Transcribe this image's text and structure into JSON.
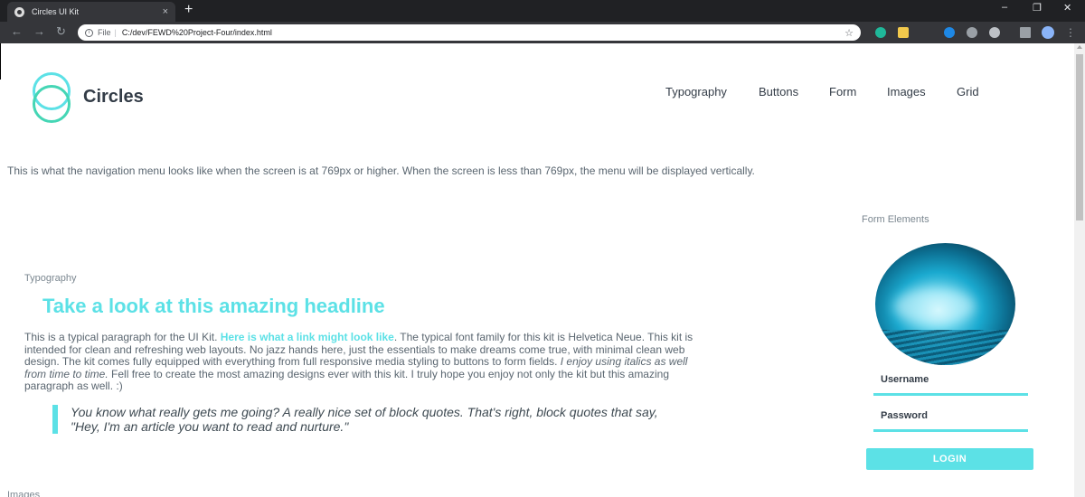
{
  "browser": {
    "tab_title": "Circles UI Kit",
    "tab_close": "×",
    "new_tab": "+",
    "window_controls": [
      "–",
      "❐",
      "✕"
    ],
    "nav": {
      "back": "←",
      "forward": "→",
      "reload": "↻"
    },
    "address": {
      "info": "i",
      "scheme": "File",
      "separator": "|",
      "url": "C:/dev/FEWD%20Project-Four/index.html",
      "star": "☆"
    }
  },
  "site": {
    "brand": "Circles",
    "nav_links": [
      "Typography",
      "Buttons",
      "Form",
      "Images",
      "Grid"
    ],
    "nav_note": "This is what the navigation menu looks like when the screen is at 769px or higher. When the screen is less than 769px, the menu will be displayed vertically."
  },
  "typography": {
    "label": "Typography",
    "headline": "Take a look at this amazing headline",
    "para_1": "This is a typical paragraph for the UI Kit. ",
    "link": "Here is what a link might look like",
    "para_2": ". The typical font family for this kit is Helvetica Neue. This kit is intended for clean and refreshing web layouts. No jazz hands here, just the essentials to make dreams come true, with minimal clean web design. The kit comes fully equipped with everything from full responsive media styling to buttons to form fields. ",
    "italic": "I enjoy using italics as well from time to time.",
    "para_3": " Fell free to create the most amazing designs ever with this kit. I truly hope you enjoy not only the kit but this amazing paragraph as well. :)",
    "blockquote": "You know what really gets me going? A really nice set of block quotes. That's right, block quotes that say, \"Hey, I'm an article you want to read and nurture.\""
  },
  "form": {
    "label": "Form Elements",
    "username_label": "Username",
    "password_label": "Password",
    "login_label": "LOGIN"
  },
  "images": {
    "label": "Images"
  },
  "colors": {
    "accent": "#5ce1e6",
    "accent_alt": "#45d6b5",
    "text": "#5a6670",
    "heading_text": "#333c47"
  }
}
